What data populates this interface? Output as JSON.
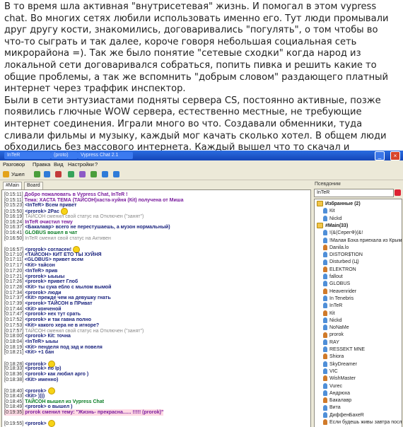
{
  "story": {
    "paragraphs": [
      "В то время шла активная \"внутрисетевая\" жизнь. И помогал в этом vypress chat. Во многих сетях любили использовать именно его. Тут люди промывали друг другу кости, знакомились, договаривались \"погулять\", о том чтобы во что-то сыграть и так далее, короче говоря небольшая социальная сеть микрорайона =). Так же было понятие \"сетевые сходки\" когда народ из локальной сети договаривался собраться, попить пивка и решить какие то общие проблемы, а так же вспомнить \"добрым словом\" раздающего платный интернет через траффик инспектор.",
      "Были в сети энтузиастами подняты сервера CS, постоянно активные, позже появились глючные WOW сервера, естественно местные, не требующие интернет соединения. Играли много во что. Создавали обменники, туда сливали фильмы и музыку, каждый мог качать сколько хотел. В общем люди обходились без массового интернета. Каждый вышел что то скачал и поделился, а все качать - было дорого."
    ]
  },
  "window": {
    "taskbar": [
      "InTeR",
      "(proto)",
      "Vypress Chat 2.1"
    ],
    "menu": [
      "Разговор",
      "Правка",
      "Вид",
      "Настройки",
      "?"
    ],
    "toolbar_label": "Ушел",
    "tabs": [
      "#Main",
      "Board"
    ],
    "nick_label": "Псевдоним",
    "nick_value": "InTeR"
  },
  "chat": [
    {
      "ts": "[0:15:11]",
      "text": "Добро пожаловать в Vypress Chat, InTeR !",
      "style": "purple"
    },
    {
      "ts": "[0:15:11]",
      "text": "Тема: ХАСТА ТЕМА (ТАЙСОН)хаста-хуйня (Кit) получена от Миша",
      "style": "purple"
    },
    {
      "ts": "[0:15:23]",
      "text": "<InTeR> Всем привет",
      "style": ""
    },
    {
      "ts": "[0:15:50]",
      "text": "<prorok> 2Pac",
      "style": "",
      "smiley": true
    },
    {
      "ts": "[0:16:19]",
      "text": "ТАЙСОН сменил свой статус на Отключен (\"занят\")",
      "style": "sys"
    },
    {
      "ts": "[0:16:24]",
      "text": "InTeR очистил тему",
      "style": "purple"
    },
    {
      "ts": "[0:16:37]",
      "text": "<Бакалавр> всего не перестушаешь, а музон нормальный)",
      "style": ""
    },
    {
      "ts": "[0:16:41]",
      "text": "GLOBUS вошел в чат",
      "style": "green"
    },
    {
      "ts": "[0:16:50]",
      "text": "InTeR сменил свой статус на Активен",
      "style": "sys"
    },
    {
      "ts": "",
      "text": "",
      "style": "sys"
    },
    {
      "ts": "[0:16:57]",
      "text": "<prorok> согласен!",
      "style": "",
      "smiley": true
    },
    {
      "ts": "[0:17:10]",
      "text": "<ТАЙСОН> КИТ ЕТО ТЫ ХУЙНЯ",
      "style": ""
    },
    {
      "ts": "[0:17:11]",
      "text": "<GLOBUS> привет всем",
      "style": ""
    },
    {
      "ts": "[0:17:17]",
      "text": "<Кit> тайсон",
      "style": ""
    },
    {
      "ts": "[0:17:20]",
      "text": "<InTeR> прив",
      "style": ""
    },
    {
      "ts": "[0:17:21]",
      "text": "<prorok> ыыыы",
      "style": ""
    },
    {
      "ts": "[0:17:26]",
      "text": "<prorok> привет Глоб",
      "style": ""
    },
    {
      "ts": "[0:17:28]",
      "text": "<Кit> ты сука ебло с мылом вымой",
      "style": ""
    },
    {
      "ts": "[0:17:34]",
      "text": "<prorok> люди",
      "style": ""
    },
    {
      "ts": "[0:17:37]",
      "text": "<Кit> прежде чем на девушку гнать",
      "style": ""
    },
    {
      "ts": "[0:17:39]",
      "text": "<prorok> ТАЙСОН в ПРиват",
      "style": ""
    },
    {
      "ts": "[0:17:44]",
      "text": "<Кit> конченой",
      "style": ""
    },
    {
      "ts": "[0:17:47]",
      "text": "<prorok> нех тут срать",
      "style": ""
    },
    {
      "ts": "[0:17:52]",
      "text": "<prorok> и так гавна полно",
      "style": ""
    },
    {
      "ts": "[0:17:53]",
      "text": "<Кit> какого хера не в игноре?",
      "style": ""
    },
    {
      "ts": "[0:17:57]",
      "text": "ТАЙСОН сменил свой статус на Отключен (\"занят\")",
      "style": "sys"
    },
    {
      "ts": "[0:18:00]",
      "text": "<prorok> Кit: точна",
      "style": ""
    },
    {
      "ts": "[0:18:04]",
      "text": "<InTeR> ыыы",
      "style": ""
    },
    {
      "ts": "[0:18:19]",
      "text": "<Кit> пенделя под зад и повеля",
      "style": ""
    },
    {
      "ts": "[0:18:21]",
      "text": "<Кit> +1 бан",
      "style": ""
    },
    {
      "ts": "",
      "text": "",
      "style": "sys"
    },
    {
      "ts": "[0:18:28]",
      "text": "<prorok>",
      "style": "",
      "smiley": true
    },
    {
      "ts": "[0:18:33]",
      "text": "<prorok> по Ip)",
      "style": ""
    },
    {
      "ts": "[0:18:36]",
      "text": "<prorok> как любил арго )",
      "style": ""
    },
    {
      "ts": "[0:18:38]",
      "text": "<Кit> именно)",
      "style": ""
    },
    {
      "ts": "",
      "text": "",
      "style": "sys"
    },
    {
      "ts": "[0:18:40]",
      "text": "<prorok>",
      "style": "",
      "smiley": true
    },
    {
      "ts": "[0:18:43]",
      "text": "<Кit> ))))",
      "style": ""
    },
    {
      "ts": "[0:18:45]",
      "text": "ТАЙСОН вышел из Vypress Chat",
      "style": "green"
    },
    {
      "ts": "[0:18:49]",
      "text": "<prorok> о вышел )",
      "style": ""
    },
    {
      "ts": "[0:19:35]",
      "text": "prorok сменил тему: \"Жизнь- прекрасна...... !!!!! (prorok)\"",
      "style": "purple pinkbg"
    },
    {
      "ts": "",
      "text": "",
      "style": "sys"
    },
    {
      "ts": "[0:19:55]",
      "text": "<prorok>",
      "style": "",
      "smiley": true
    }
  ],
  "users": [
    {
      "name": "Избранные (2)",
      "kind": "group"
    },
    {
      "name": "Кit",
      "kind": "user"
    },
    {
      "name": "Nickd",
      "kind": "user"
    },
    {
      "name": "#Main(33)",
      "kind": "group"
    },
    {
      "name": "!(&(СерегФ)(&!",
      "kind": "user"
    },
    {
      "name": "!Малая Бэха приехала из Крыма",
      "kind": "user"
    },
    {
      "name": "Danila.lo",
      "kind": "user"
    },
    {
      "name": "DISTOR$TION",
      "kind": "user"
    },
    {
      "name": "Disturbed (Ц)",
      "kind": "user"
    },
    {
      "name": "ELEKTRON",
      "kind": "user"
    },
    {
      "name": "fallout",
      "kind": "user"
    },
    {
      "name": "GLOBUS",
      "kind": "user"
    },
    {
      "name": "Heavenrider",
      "kind": "user"
    },
    {
      "name": "In Tenebris",
      "kind": "user"
    },
    {
      "name": "InTeR",
      "kind": "user"
    },
    {
      "name": "Кit",
      "kind": "user"
    },
    {
      "name": "Nickd",
      "kind": "user"
    },
    {
      "name": "NoNaMe",
      "kind": "user"
    },
    {
      "name": "prorok",
      "kind": "user"
    },
    {
      "name": "RAY",
      "kind": "user"
    },
    {
      "name": "RESSEKT MNE",
      "kind": "user"
    },
    {
      "name": "Shiora",
      "kind": "user"
    },
    {
      "name": "SkyDreamer",
      "kind": "user"
    },
    {
      "name": "VIC",
      "kind": "user"
    },
    {
      "name": "WishMaster",
      "kind": "user"
    },
    {
      "name": "Vurec",
      "kind": "user"
    },
    {
      "name": "Андрюха",
      "kind": "user"
    },
    {
      "name": "Бакалавр",
      "kind": "user"
    },
    {
      "name": "Вита",
      "kind": "user"
    },
    {
      "name": "ДиффенБахеR",
      "kind": "user"
    },
    {
      "name": "Если будешь живы завтра после",
      "kind": "user"
    }
  ],
  "colors": {
    "titlebar": "#1546b8",
    "nick_text": "#1a237e",
    "system_text": "#888888",
    "join_text": "#0a7d25",
    "topic_text": "#7a1d9e"
  }
}
